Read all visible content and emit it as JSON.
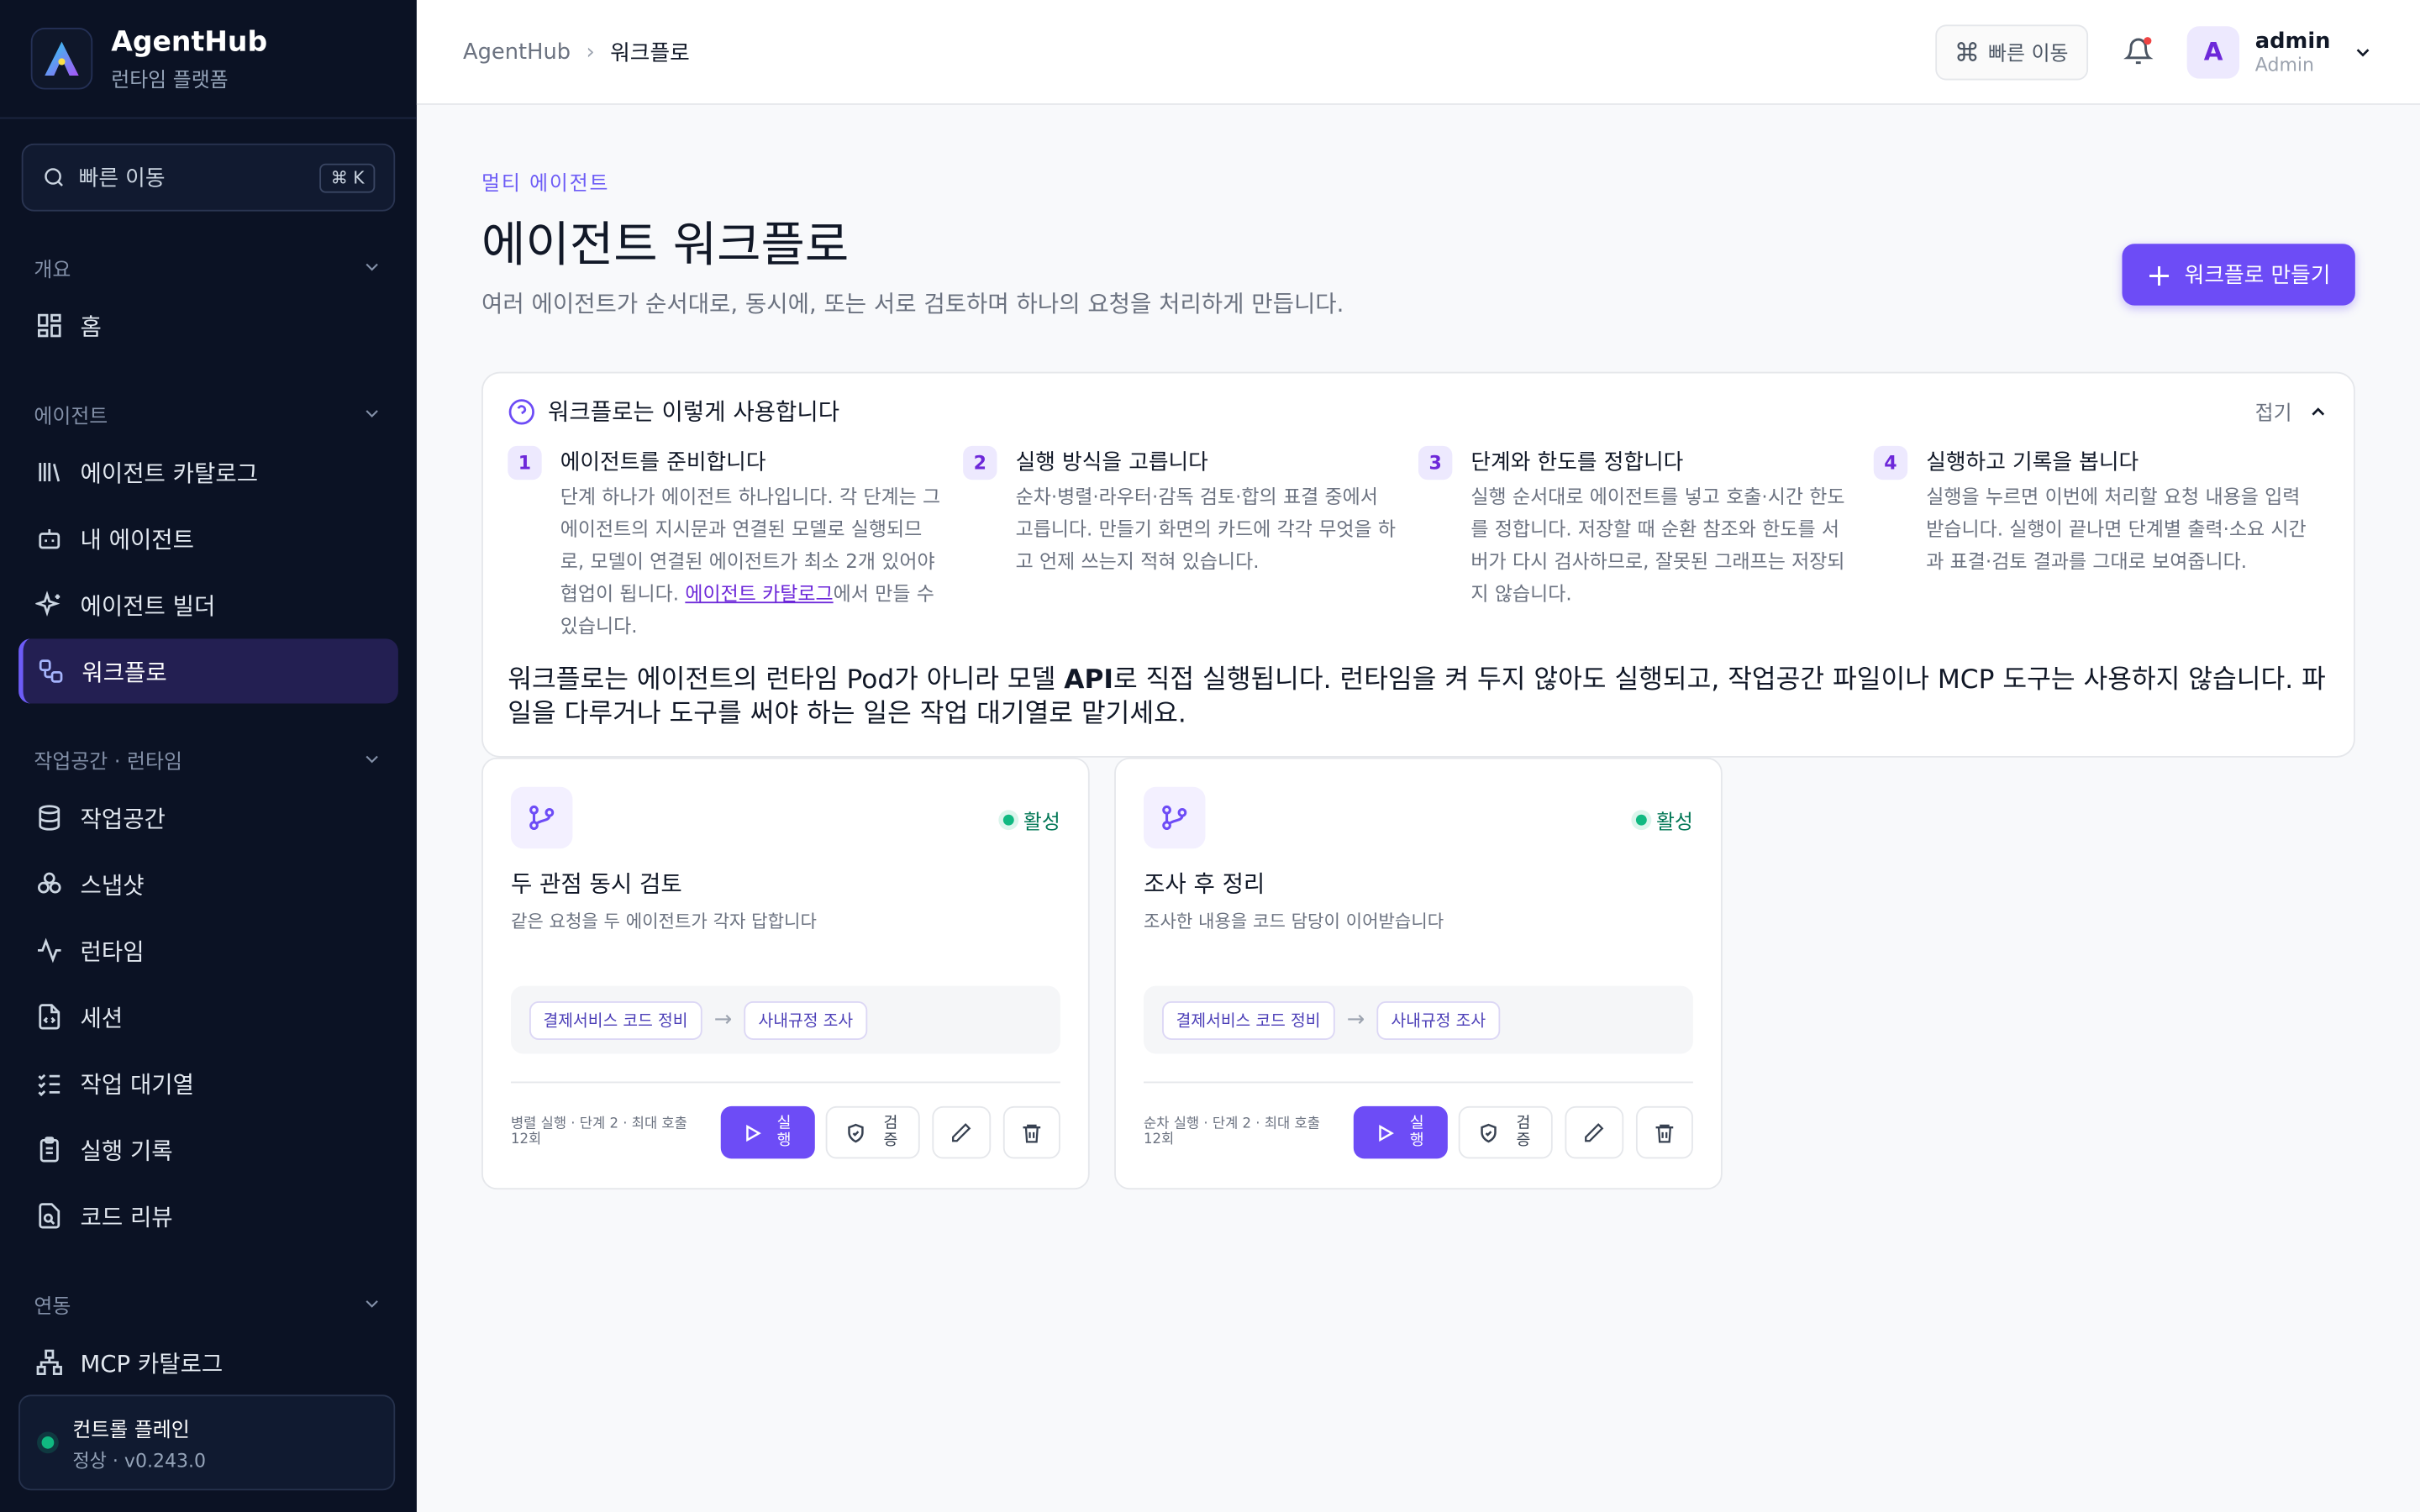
{
  "brand": {
    "name": "AgentHub",
    "subtitle": "런타임 플랫폼"
  },
  "sidebar": {
    "search_label": "빠른 이동",
    "search_shortcut": "⌘ K",
    "groups": [
      {
        "label": "개요",
        "items": [
          {
            "label": "홈",
            "icon": "home-grid-icon"
          }
        ]
      },
      {
        "label": "에이전트",
        "items": [
          {
            "label": "에이전트 카탈로그",
            "icon": "library-icon"
          },
          {
            "label": "내 에이전트",
            "icon": "bot-icon"
          },
          {
            "label": "에이전트 빌더",
            "icon": "sparkles-icon"
          },
          {
            "label": "워크플로",
            "icon": "workflow-icon",
            "active": true
          }
        ]
      },
      {
        "label": "작업공간 · 런타임",
        "items": [
          {
            "label": "작업공간",
            "icon": "database-icon"
          },
          {
            "label": "스냅샷",
            "icon": "boxes-icon"
          },
          {
            "label": "런타임",
            "icon": "activity-icon"
          },
          {
            "label": "세션",
            "icon": "file-code-icon"
          },
          {
            "label": "작업 대기열",
            "icon": "list-checks-icon"
          },
          {
            "label": "실행 기록",
            "icon": "clipboard-icon"
          },
          {
            "label": "코드 리뷰",
            "icon": "file-search-icon"
          }
        ]
      },
      {
        "label": "연동",
        "items": [
          {
            "label": "MCP 카탈로그",
            "icon": "network-icon"
          }
        ]
      }
    ],
    "control_plane": {
      "title": "컨트롤 플레인",
      "status": "정상 · v0.243.0"
    }
  },
  "topbar": {
    "breadcrumb": [
      "AgentHub",
      "워크플로"
    ],
    "quick_label": "빠른 이동",
    "user": {
      "initial": "A",
      "name": "admin",
      "role": "Admin"
    }
  },
  "page": {
    "eyebrow": "멀티 에이전트",
    "title": "에이전트 워크플로",
    "description": "여러 에이전트가 순서대로, 동시에, 또는 서로 검토하며 하나의 요청을 처리하게 만듭니다.",
    "create_label": "워크플로 만들기"
  },
  "guide": {
    "title": "워크플로는 이렇게 사용합니다",
    "fold_label": "접기",
    "steps": [
      {
        "num": "1",
        "title": "에이전트를 준비합니다",
        "desc_before": "단계 하나가 에이전트 하나입니다. 각 단계는 그 에이전트의 지시문과 연결된 모델로 실행되므로, 모델이 연결된 에이전트가 최소 2개 있어야 협업이 됩니다. ",
        "link": "에이전트 카탈로그",
        "desc_after": "에서 만들 수 있습니다."
      },
      {
        "num": "2",
        "title": "실행 방식을 고릅니다",
        "desc": "순차·병렬·라우터·감독 검토·합의 표결 중에서 고릅니다. 만들기 화면의 카드에 각각 무엇을 하고 언제 쓰는지 적혀 있습니다."
      },
      {
        "num": "3",
        "title": "단계와 한도를 정합니다",
        "desc": "실행 순서대로 에이전트를 넣고 호출·시간 한도를 정합니다. 저장할 때 순환 참조와 한도를 서버가 다시 검사하므로, 잘못된 그래프는 저장되지 않습니다."
      },
      {
        "num": "4",
        "title": "실행하고 기록을 봅니다",
        "desc": "실행을 누르면 이번에 처리할 요청 내용을 입력받습니다. 실행이 끝나면 단계별 출력·소요 시간과 표결·검토 결과를 그대로 보여줍니다."
      }
    ],
    "note_parts": [
      "워크플로는 에이전트의 런타임 Pod가 아니라 모델 ",
      "API",
      "로 직접 실행됩니다. 런타임을 켜 두지 않아도 실행되고, 작업공간 파일이나 MCP 도구는 사용하지 않습니다. 파일을 다루거나 도구를 써야 하는 일은 작업 대기열로 맡기세요."
    ]
  },
  "workflows": [
    {
      "title": "두 관점 동시 검토",
      "subtitle": "같은 요청을 두 에이전트가 각자 답합니다",
      "status": "활성",
      "steps": [
        "결제서비스 코드 정비",
        "사내규정 조사"
      ],
      "arrow": "→",
      "meta": "병렬 실행 · 단계 2 · 최대 호출 12회",
      "run_label": "실행",
      "verify_label": "검증"
    },
    {
      "title": "조사 후 정리",
      "subtitle": "조사한 내용을 코드 담당이 이어받습니다",
      "status": "활성",
      "steps": [
        "결제서비스 코드 정비",
        "사내규정 조사"
      ],
      "arrow": "→",
      "meta": "순차 실행 · 단계 2 · 최대 호출 12회",
      "run_label": "실행",
      "verify_label": "검증"
    }
  ],
  "colors": {
    "accent": "#6d4cf6",
    "sidebar_bg": "#0b1224",
    "active_status": "#10b981"
  }
}
